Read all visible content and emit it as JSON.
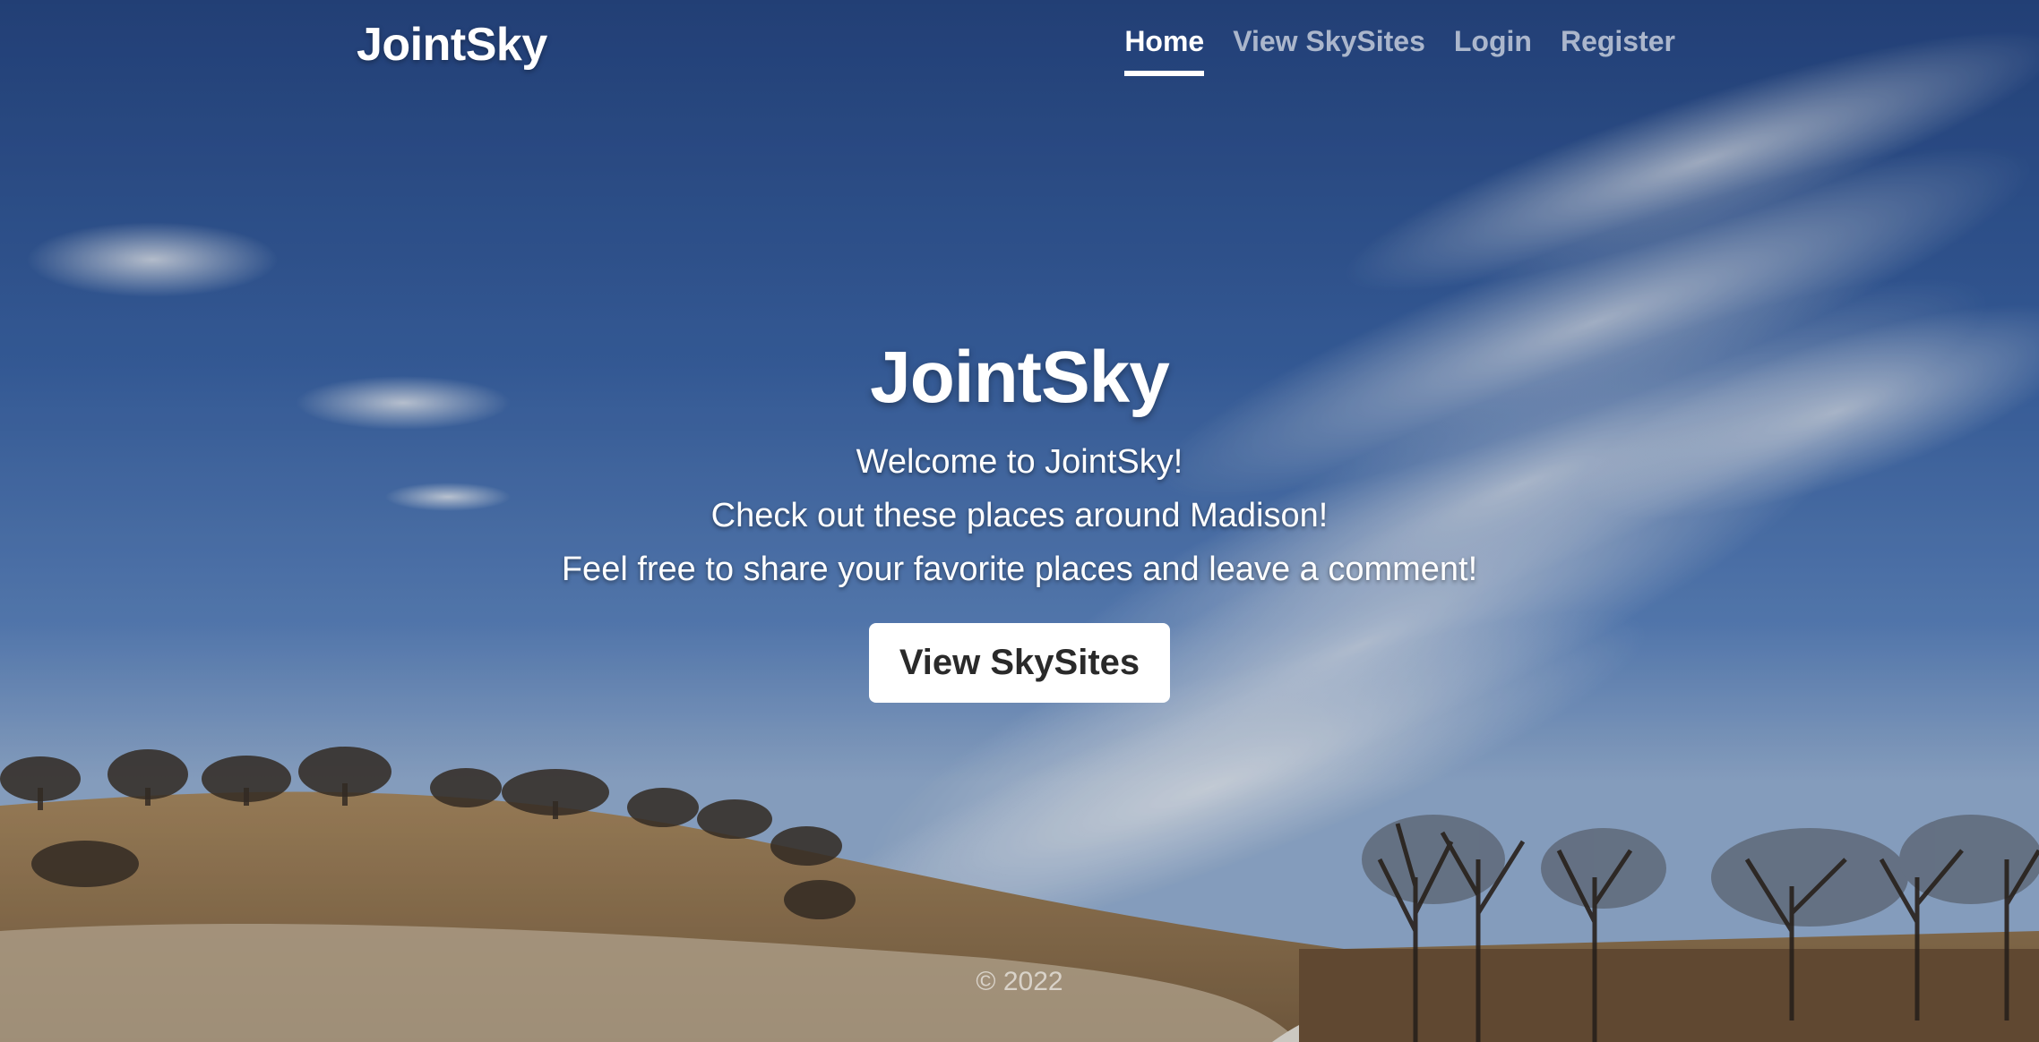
{
  "navbar": {
    "brand": "JointSky",
    "links": [
      {
        "label": "Home",
        "active": true
      },
      {
        "label": "View SkySites",
        "active": false
      },
      {
        "label": "Login",
        "active": false
      },
      {
        "label": "Register",
        "active": false
      }
    ]
  },
  "hero": {
    "title": "JointSky",
    "lines": [
      "Welcome to JointSky!",
      "Check out these places around Madison!",
      "Feel free to share your favorite places and leave a comment!"
    ],
    "button_label": "View SkySites"
  },
  "footer": {
    "copyright": "© 2022"
  },
  "colors": {
    "sky_top": "#2b4d8c",
    "sky_mid": "#4f7fc0",
    "grass": "#a9895f",
    "button_bg": "#ffffff",
    "button_text": "#2a2a2a"
  }
}
